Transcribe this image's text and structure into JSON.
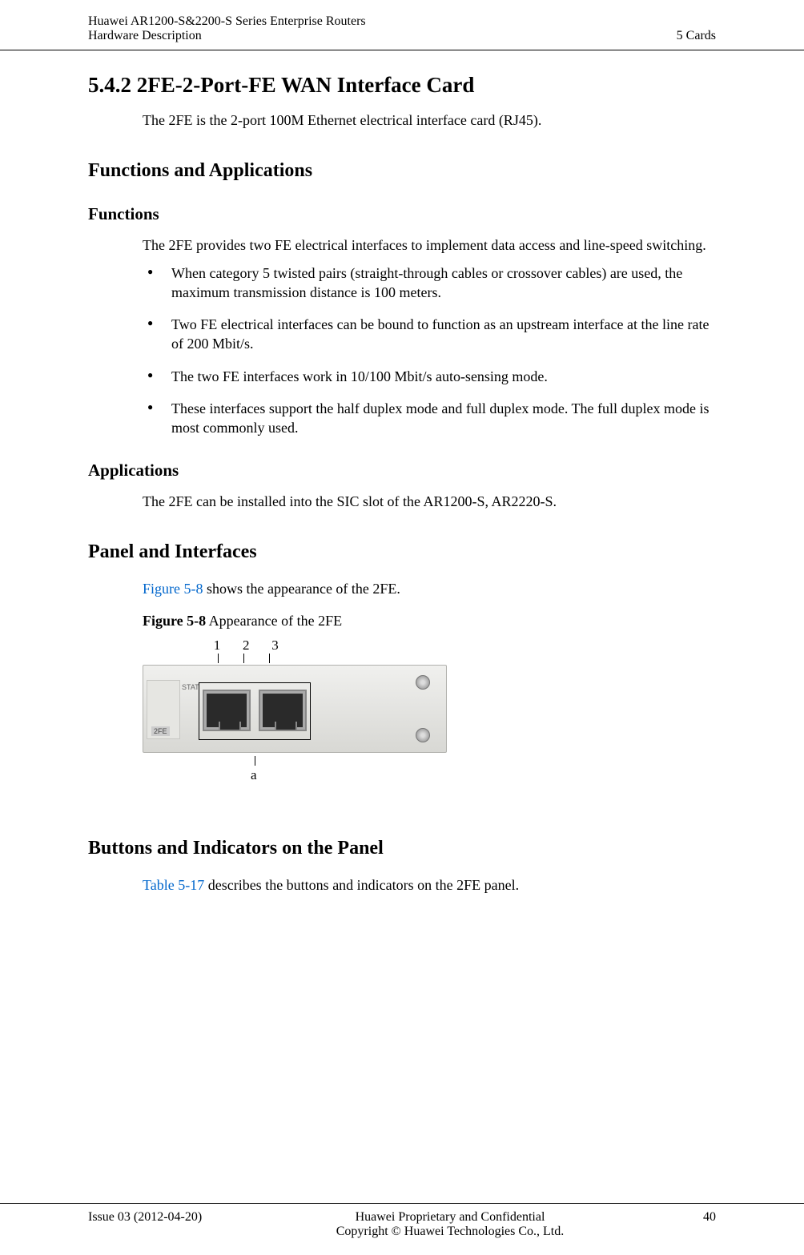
{
  "header": {
    "product_line1": "Huawei AR1200-S&2200-S Series Enterprise Routers",
    "product_line2": "Hardware Description",
    "chapter": "5 Cards"
  },
  "section": {
    "title": "5.4.2 2FE-2-Port-FE WAN Interface Card",
    "intro": "The 2FE is the 2-port 100M Ethernet electrical interface card (RJ45)."
  },
  "functions_apps_heading": "Functions and Applications",
  "functions": {
    "heading": "Functions",
    "intro": "The 2FE provides two FE electrical interfaces to implement data access and line-speed switching.",
    "bullets": [
      "When category 5 twisted pairs (straight-through cables or crossover cables) are used, the maximum transmission distance is 100 meters.",
      "Two FE electrical interfaces can be bound to function as an upstream interface at the line rate of 200 Mbit/s.",
      "The two FE interfaces work in 10/100 Mbit/s auto-sensing mode.",
      "These interfaces support the half duplex mode and full duplex mode. The full duplex mode is most commonly used."
    ]
  },
  "applications": {
    "heading": "Applications",
    "text": "The 2FE can be installed into the SIC slot of the AR1200-S, AR2220-S."
  },
  "panel": {
    "heading": "Panel and Interfaces",
    "intro_pre": "",
    "figure_ref": "Figure 5-8",
    "intro_post": " shows the appearance of the 2FE.",
    "caption_bold": "Figure 5-8",
    "caption_rest": " Appearance of the 2FE",
    "labels": {
      "n1": "1",
      "n2": "2",
      "n3": "3",
      "a": "a"
    },
    "card": {
      "stat": "STAT",
      "fe": "2FE"
    }
  },
  "buttons_heading": "Buttons and Indicators on the Panel",
  "buttons_text_pre": "",
  "table_ref": "Table 5-17",
  "buttons_text_post": " describes the buttons and indicators on the 2FE panel.",
  "footer": {
    "issue": "Issue 03 (2012-04-20)",
    "conf": "Huawei Proprietary and Confidential",
    "copyright": "Copyright © Huawei Technologies Co., Ltd.",
    "page": "40"
  }
}
